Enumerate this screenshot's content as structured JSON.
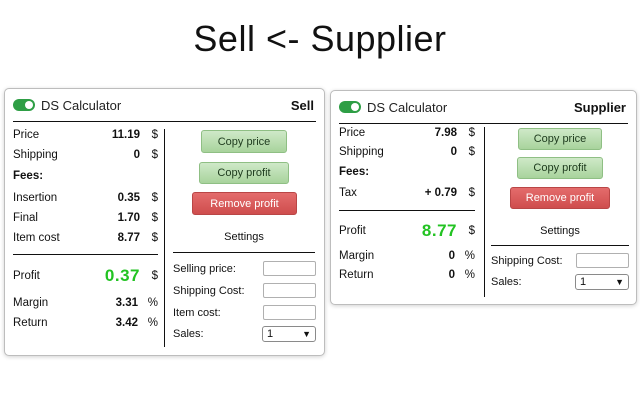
{
  "page_title": "Sell <- Supplier",
  "sell": {
    "app_name": "DS Calculator",
    "mode": "Sell",
    "rows": {
      "price": {
        "label": "Price",
        "value": "11.19",
        "unit": "$"
      },
      "shipping": {
        "label": "Shipping",
        "value": "0",
        "unit": "$"
      },
      "fees": {
        "label": "Fees:"
      },
      "insertion": {
        "label": "Insertion",
        "value": "0.35",
        "unit": "$"
      },
      "final": {
        "label": "Final",
        "value": "1.70",
        "unit": "$"
      },
      "item_cost": {
        "label": "Item cost",
        "value": "8.77",
        "unit": "$"
      },
      "profit": {
        "label": "Profit",
        "value": "0.37",
        "unit": "$"
      },
      "margin": {
        "label": "Margin",
        "value": "3.31",
        "unit": "%"
      },
      "return": {
        "label": "Return",
        "value": "3.42",
        "unit": "%"
      }
    },
    "buttons": {
      "copy_price": "Copy price",
      "copy_profit": "Copy profit",
      "remove_profit": "Remove profit"
    },
    "settings": {
      "title": "Settings",
      "selling_price": {
        "label": "Selling price:",
        "value": ""
      },
      "shipping_cost": {
        "label": "Shipping Cost:",
        "value": ""
      },
      "item_cost": {
        "label": "Item cost:",
        "value": ""
      },
      "sales": {
        "label": "Sales:",
        "value": "1"
      }
    }
  },
  "supplier": {
    "app_name": "DS Calculator",
    "mode": "Supplier",
    "rows": {
      "price": {
        "label": "Price",
        "value": "7.98",
        "unit": "$"
      },
      "shipping": {
        "label": "Shipping",
        "value": "0",
        "unit": "$"
      },
      "fees": {
        "label": "Fees:"
      },
      "tax": {
        "label": "Tax",
        "value": "+ 0.79",
        "unit": "$"
      },
      "profit": {
        "label": "Profit",
        "value": "8.77",
        "unit": "$"
      },
      "margin": {
        "label": "Margin",
        "value": "0",
        "unit": "%"
      },
      "return": {
        "label": "Return",
        "value": "0",
        "unit": "%"
      }
    },
    "buttons": {
      "copy_price": "Copy price",
      "copy_profit": "Copy profit",
      "remove_profit": "Remove profit"
    },
    "settings": {
      "title": "Settings",
      "shipping_cost": {
        "label": "Shipping Cost:",
        "value": ""
      },
      "sales": {
        "label": "Sales:",
        "value": "1"
      }
    }
  },
  "colors": {
    "toggle_on": "#2e9e45",
    "profit": "#22c322",
    "copy_button": "#b9ddb0",
    "remove_button": "#d85a5a"
  },
  "icons": {
    "toggle": "toggle-on-icon",
    "dropdown": "chevron-down-icon"
  }
}
